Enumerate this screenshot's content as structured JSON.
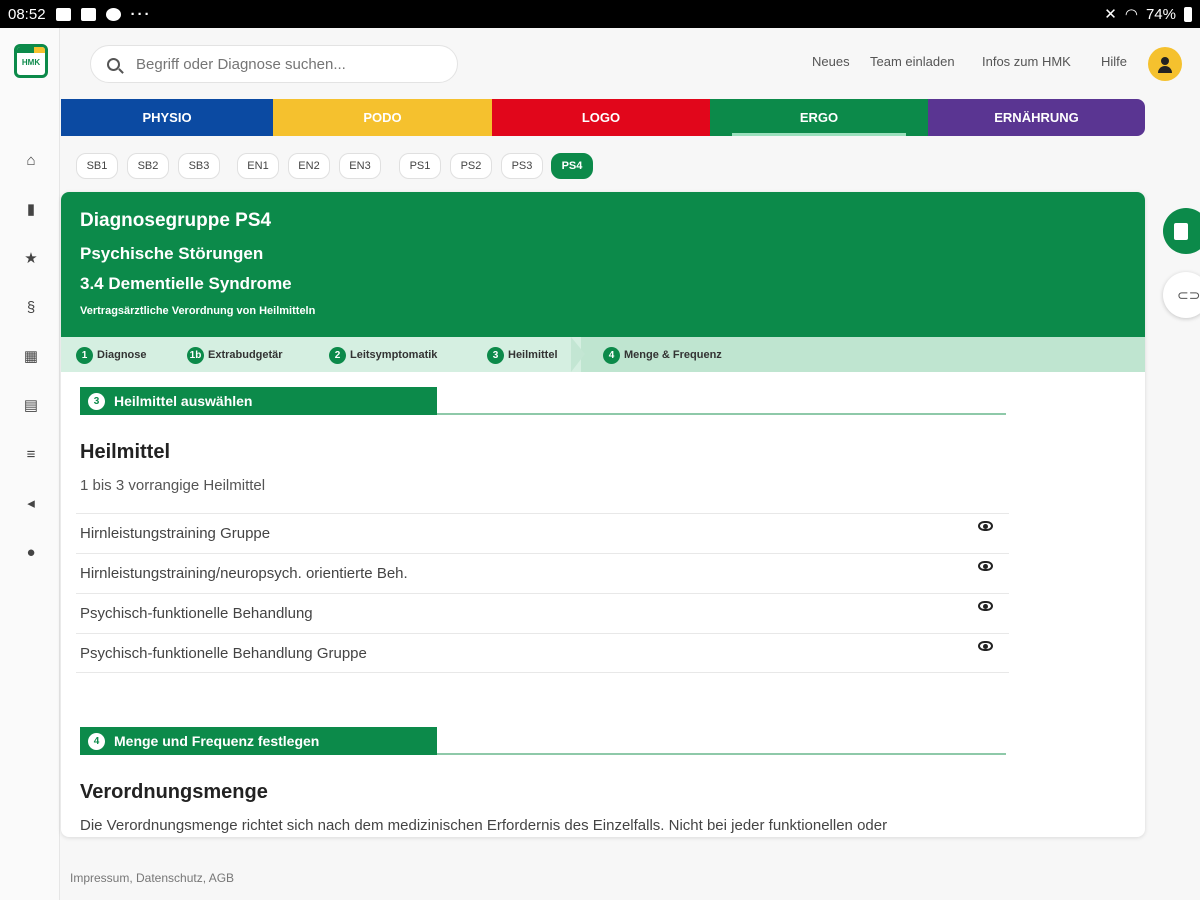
{
  "statusbar": {
    "time": "08:52",
    "more": "···",
    "battery": "74%"
  },
  "logo": {
    "text": "HMK"
  },
  "search": {
    "placeholder": "Begriff oder Diagnose suchen..."
  },
  "topnav": {
    "news": "Neues",
    "invite": "Team einladen",
    "info": "Infos zum HMK",
    "help": "Hilfe"
  },
  "categories": [
    {
      "label": "PHYSIO",
      "color": "#0b4aa2"
    },
    {
      "label": "PODO",
      "color": "#f5c12e"
    },
    {
      "label": "LOGO",
      "color": "#e1061b"
    },
    {
      "label": "ERGO",
      "color": "#0c8a4a"
    },
    {
      "label": "ERNÄHRUNG",
      "color": "#5a3592"
    }
  ],
  "groups": [
    "SB1",
    "SB2",
    "SB3",
    "EN1",
    "EN2",
    "EN3",
    "PS1",
    "PS2",
    "PS3",
    "PS4"
  ],
  "active_group": "PS4",
  "card": {
    "title": "Diagnosegruppe PS4",
    "subtitle": "Psychische Störungen",
    "diagnosis": "3.4 Dementielle Syndrome",
    "note": "Vertragsärztliche Verordnung von Heilmitteln"
  },
  "steps": [
    {
      "num": "1",
      "label": "Diagnose"
    },
    {
      "num": "1b",
      "label": "Extrabudgetär"
    },
    {
      "num": "2",
      "label": "Leitsymptomatik"
    },
    {
      "num": "3",
      "label": "Heilmittel"
    },
    {
      "num": "4",
      "label": "Menge & Frequenz"
    }
  ],
  "section3": {
    "num": "3",
    "label": "Heilmittel auswählen",
    "heading": "Heilmittel",
    "hint": "1 bis 3 vorrangige Heilmittel",
    "items": [
      "Hirnleistungstraining Gruppe",
      "Hirnleistungstraining/neuropsych. orientierte Beh.",
      "Psychisch-funktionelle Behandlung",
      "Psychisch-funktionelle Behandlung Gruppe"
    ]
  },
  "section4": {
    "num": "4",
    "label": "Menge und Frequenz festlegen",
    "heading": "Verordnungsmenge",
    "text": "Die Verordnungsmenge richtet sich nach dem medizinischen Erfordernis des Einzelfalls. Nicht bei jeder funktionellen oder"
  },
  "footer": {
    "links": "Impressum, Datenschutz, AGB"
  },
  "icons": {
    "sidebar": [
      "home-icon",
      "book-icon",
      "star-icon",
      "paragraph-icon",
      "grid-icon",
      "document-icon",
      "list-icon",
      "megaphone-icon",
      "user-icon"
    ]
  }
}
